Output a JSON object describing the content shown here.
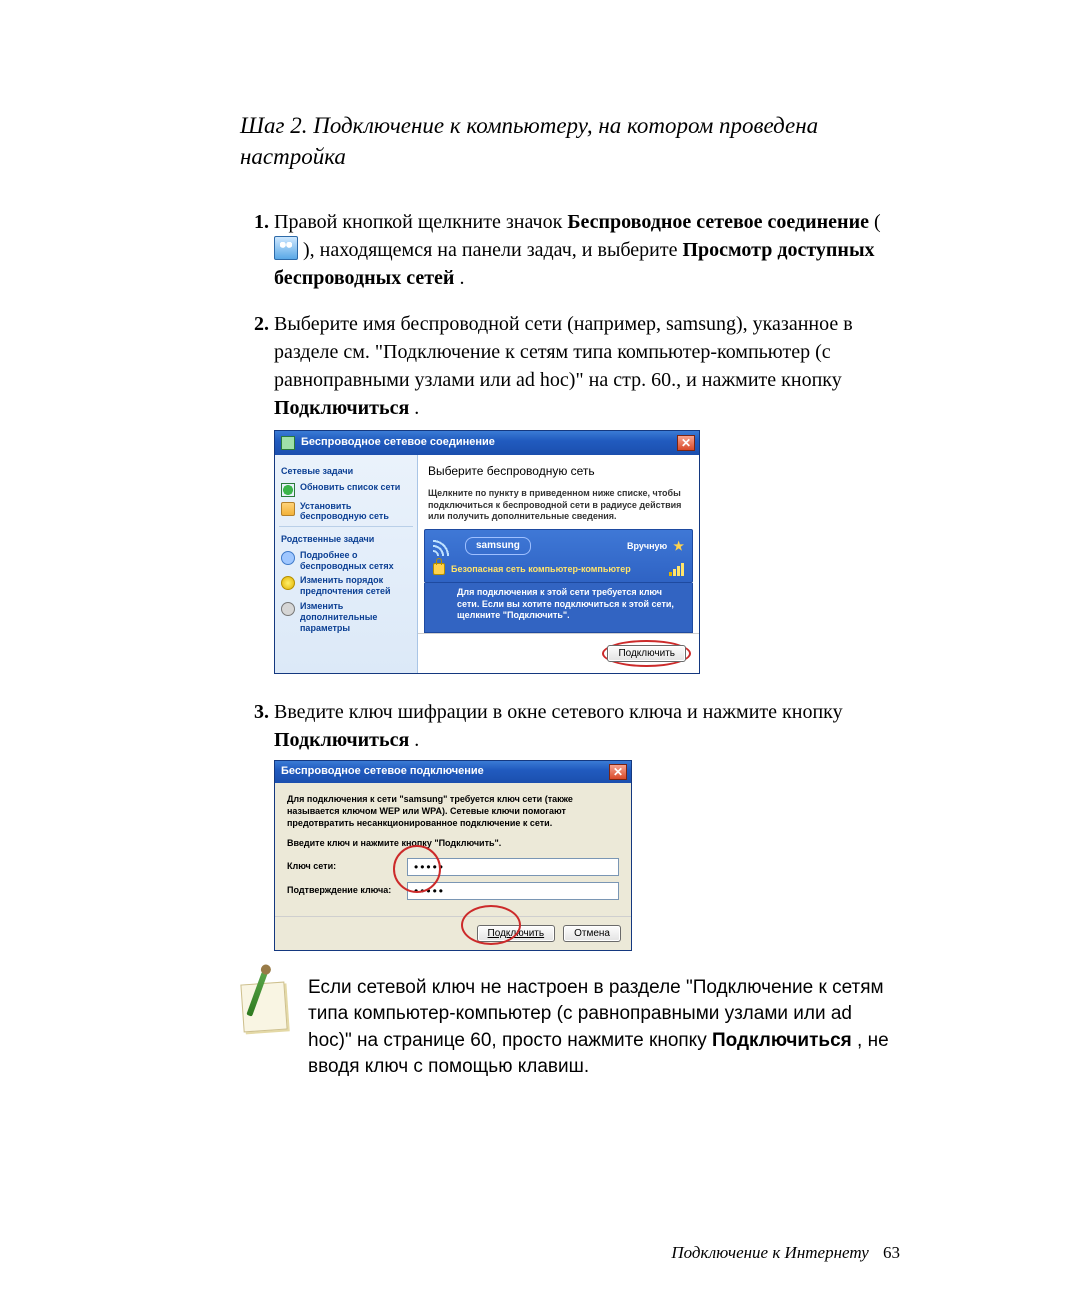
{
  "heading": "Шаг 2. Подключение к компьютеру, на котором проведена настройка",
  "step1": {
    "t1": "Правой кнопкой щелкните значок ",
    "b1": "Беспроводное сетевое соединение",
    "t2": " (",
    "t3": "), находящемся на панели задач, и выберите ",
    "b2": "Просмотр доступных беспроводных сетей",
    "t4": "."
  },
  "step2": {
    "t1": "Выберите имя беспроводной сети (например, samsung), указанное в разделе см. \"Подключение к сетям типа компьютер-компьютер (с равноправными узлами или ad hoc)\" на стр. 60., и нажмите кнопку ",
    "b1": "Подключиться",
    "t2": "."
  },
  "step3": {
    "t1": "Введите ключ шифрации в окне сетевого ключа и нажмите кнопку ",
    "b1": "Подключиться",
    "t2": "."
  },
  "dlg1": {
    "title": "Беспроводное сетевое соединение",
    "sidebar": {
      "group1_title": "Сетевые задачи",
      "items1": [
        "Обновить список сети",
        "Установить беспроводную сеть"
      ],
      "group2_title": "Родственные задачи",
      "items2": [
        "Подробнее о беспроводных сетях",
        "Изменить порядок предпочтения сетей",
        "Изменить дополнительные параметры"
      ]
    },
    "main_title": "Выберите беспроводную сеть",
    "main_sub": "Щелкните по пункту в приведенном ниже списке, чтобы подключиться к беспроводной сети в радиусе действия или получить дополнительные сведения.",
    "ssid": "samsung",
    "mode": "Вручную",
    "security": "Безопасная сеть компьютер-компьютер",
    "req": "Для подключения к этой сети требуется ключ сети. Если вы хотите подключиться к этой сети, щелкните \"Подключить\".",
    "connect_btn": "Подключить"
  },
  "dlg2": {
    "title": "Беспроводное сетевое подключение",
    "para1": "Для подключения к сети \"samsung\" требуется ключ сети (также называется ключом WEP или WPA). Сетевые ключи помогают предотвратить несанкционированное подключение к сети.",
    "para2": "Введите ключ и нажмите кнопку \"Подключить\".",
    "key_label": "Ключ сети:",
    "confirm_label": "Подтверждение ключа:",
    "key_value": "•••••",
    "connect_btn": "Подключить",
    "cancel_btn": "Отмена"
  },
  "note": {
    "t1": "Если сетевой ключ не настроен в разделе \"Подключение к сетям типа компьютер-компьютер (с равноправными узлами или ad hoc)\" на странице 60, просто нажмите кнопку ",
    "b1": "Подключиться",
    "t2": ", не вводя ключ с помощью клавиш."
  },
  "footer": {
    "text": "Подключение к Интернету",
    "page": "63"
  }
}
